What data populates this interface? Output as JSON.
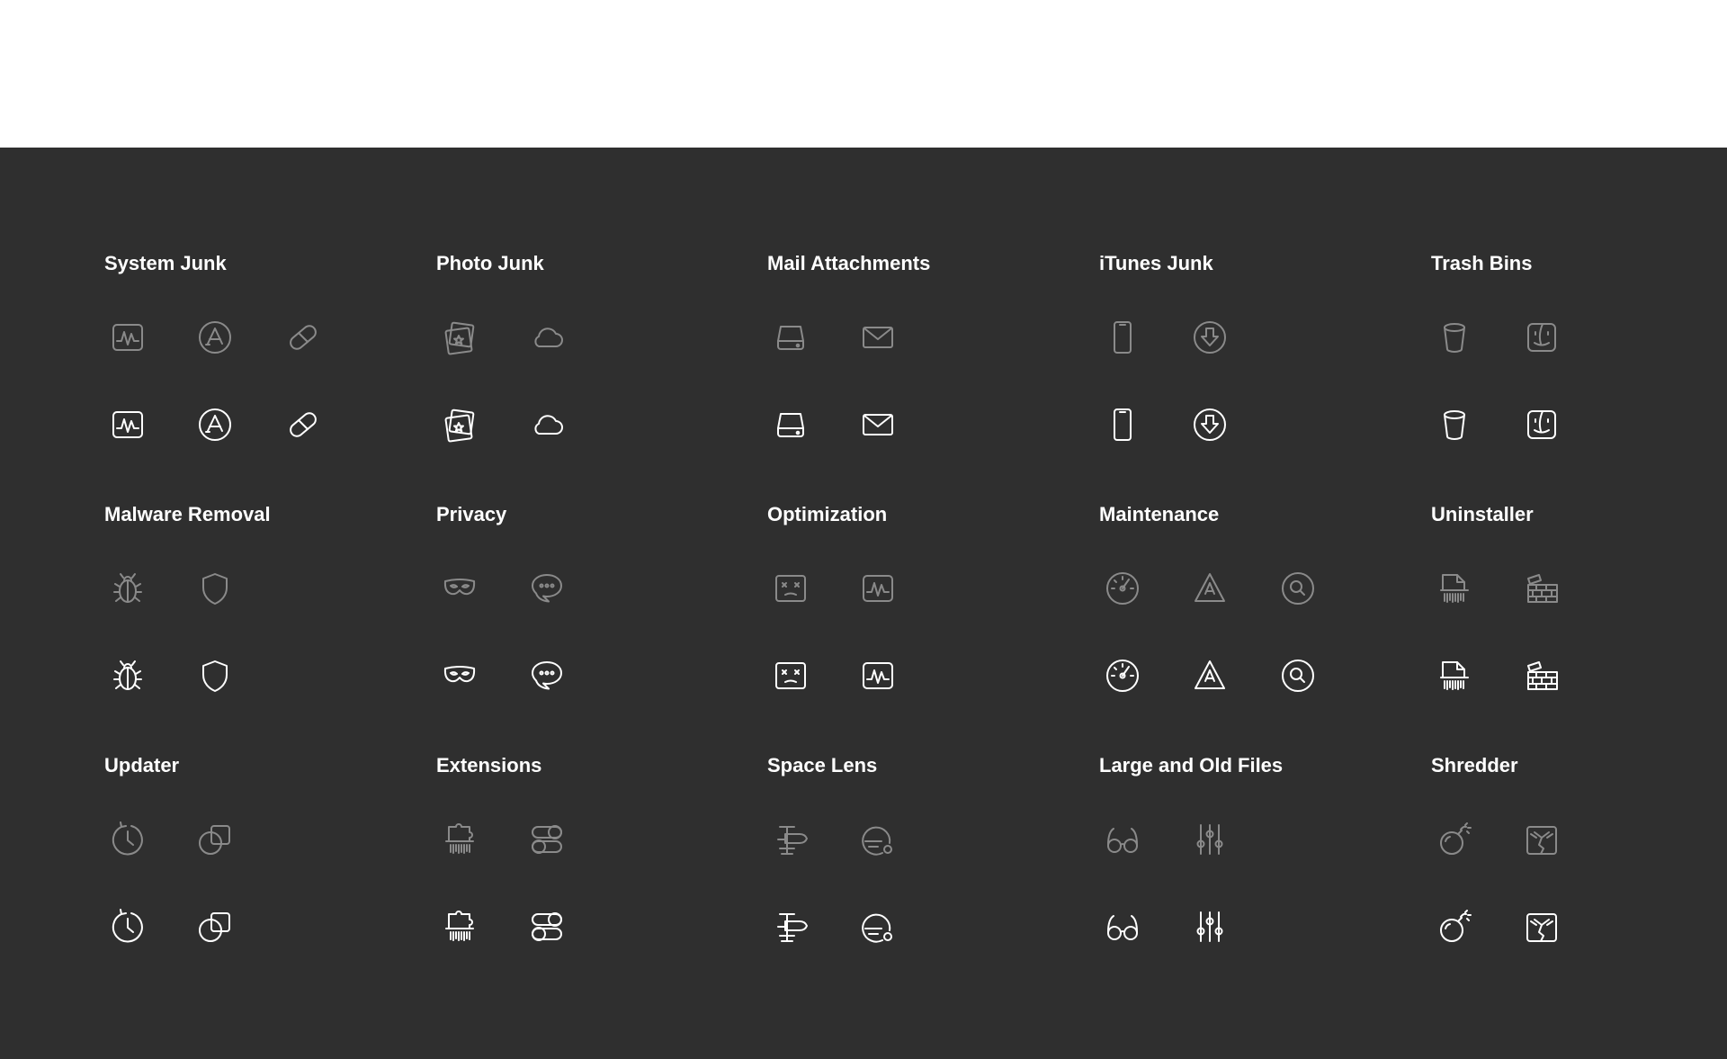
{
  "colors": {
    "panel_background": "#2f2f2f",
    "top_background": "#ffffff",
    "title_text": "#ffffff",
    "icon_muted": "#8a8a8a",
    "icon_active": "#ffffff"
  },
  "sections": [
    {
      "title": "System Junk",
      "icons": [
        "activity-monitor-icon",
        "app-store-icon",
        "pill-icon"
      ]
    },
    {
      "title": "Photo Junk",
      "icons": [
        "photos-icon",
        "cloud-icon"
      ]
    },
    {
      "title": "Mail Attachments",
      "icons": [
        "drive-icon",
        "mail-icon"
      ]
    },
    {
      "title": "iTunes Junk",
      "icons": [
        "iphone-icon",
        "download-icon"
      ]
    },
    {
      "title": "Trash Bins",
      "icons": [
        "trash-bin-icon",
        "finder-icon"
      ]
    },
    {
      "title": "Malware Removal",
      "icons": [
        "bug-icon",
        "shield-icon"
      ]
    },
    {
      "title": "Privacy",
      "icons": [
        "mask-icon",
        "chat-bubble-icon"
      ]
    },
    {
      "title": "Optimization",
      "icons": [
        "dead-face-icon",
        "activity-monitor-icon"
      ]
    },
    {
      "title": "Maintenance",
      "icons": [
        "speedometer-icon",
        "warning-app-icon",
        "search-icon"
      ]
    },
    {
      "title": "Uninstaller",
      "icons": [
        "shredded-file-icon",
        "brick-wall-icon"
      ]
    },
    {
      "title": "Updater",
      "icons": [
        "clock-refresh-icon",
        "overlapping-shapes-icon"
      ]
    },
    {
      "title": "Extensions",
      "icons": [
        "puzzle-shredder-icon",
        "toggles-icon"
      ]
    },
    {
      "title": "Space Lens",
      "icons": [
        "signpost-icon",
        "planet-lens-icon"
      ]
    },
    {
      "title": "Large and Old Files",
      "icons": [
        "glasses-icon",
        "sliders-icon"
      ]
    },
    {
      "title": "Shredder",
      "icons": [
        "bomb-icon",
        "shredded-box-icon"
      ]
    }
  ]
}
